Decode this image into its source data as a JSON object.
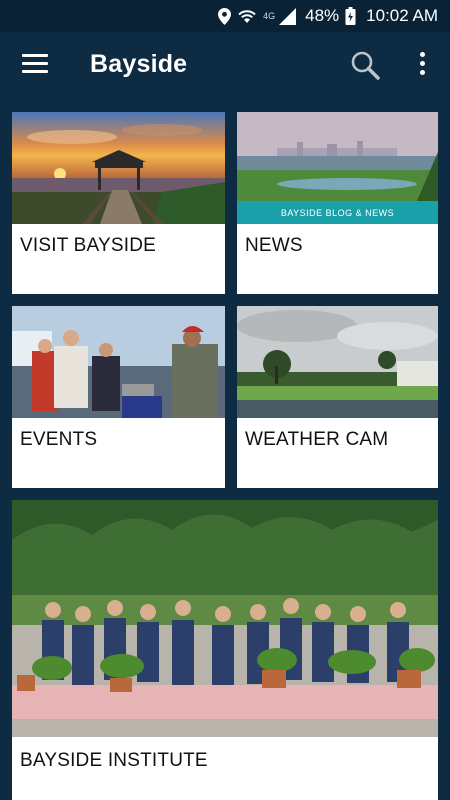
{
  "status_bar": {
    "network": "4G",
    "battery": "48%",
    "time": "10:02 AM"
  },
  "app_bar": {
    "title": "Bayside"
  },
  "tiles": [
    {
      "label": "VISIT BAYSIDE"
    },
    {
      "label": "NEWS",
      "banner": "BAYSIDE BLOG & NEWS"
    },
    {
      "label": "EVENTS"
    },
    {
      "label": "WEATHER CAM"
    },
    {
      "label": "BAYSIDE INSTITUTE"
    }
  ],
  "colors": {
    "app_bar": "#0d2b42",
    "status_bar": "#0a2236",
    "news_banner": "#1aa0a8"
  },
  "icons": {
    "menu": "hamburger-menu-icon",
    "search": "search-icon",
    "more": "more-vert-icon",
    "location": "location-pin-icon",
    "wifi": "wifi-icon",
    "signal": "signal-icon",
    "battery": "battery-charging-icon"
  }
}
